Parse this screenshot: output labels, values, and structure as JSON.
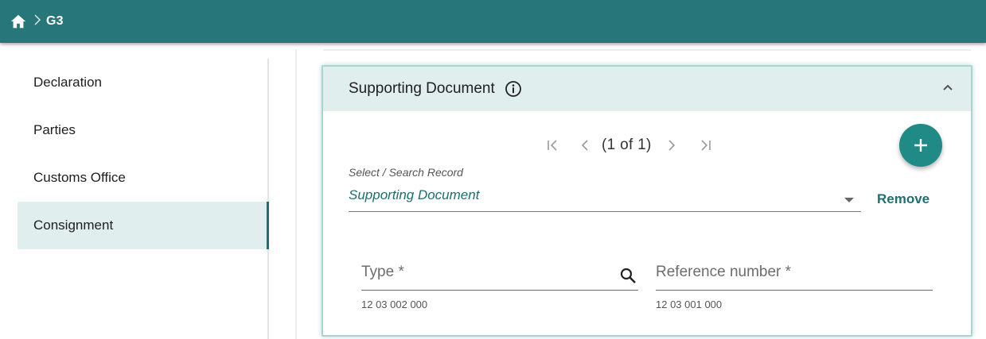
{
  "breadcrumb": {
    "current": "G3"
  },
  "sidebar": {
    "items": [
      {
        "label": "Declaration"
      },
      {
        "label": "Parties"
      },
      {
        "label": "Customs Office"
      },
      {
        "label": "Consignment"
      }
    ],
    "active_index": 3
  },
  "panel": {
    "title": "Supporting Document",
    "pager": {
      "count_text": "(1 of 1)",
      "first": "|<",
      "prev": "<",
      "next": ">",
      "last": ">|"
    },
    "select": {
      "label": "Select / Search Record",
      "value": "Supporting Document"
    },
    "remove_label": "Remove",
    "fields": [
      {
        "placeholder": "Type *",
        "code": "12 03 002 000",
        "icon": "search-icon"
      },
      {
        "placeholder": "Reference number *",
        "code": "12 03 001 000"
      }
    ]
  },
  "colors": {
    "header": "#27777a",
    "accent": "#1f8a86",
    "active_bg": "#e1eeee",
    "link": "#1f6f72"
  }
}
